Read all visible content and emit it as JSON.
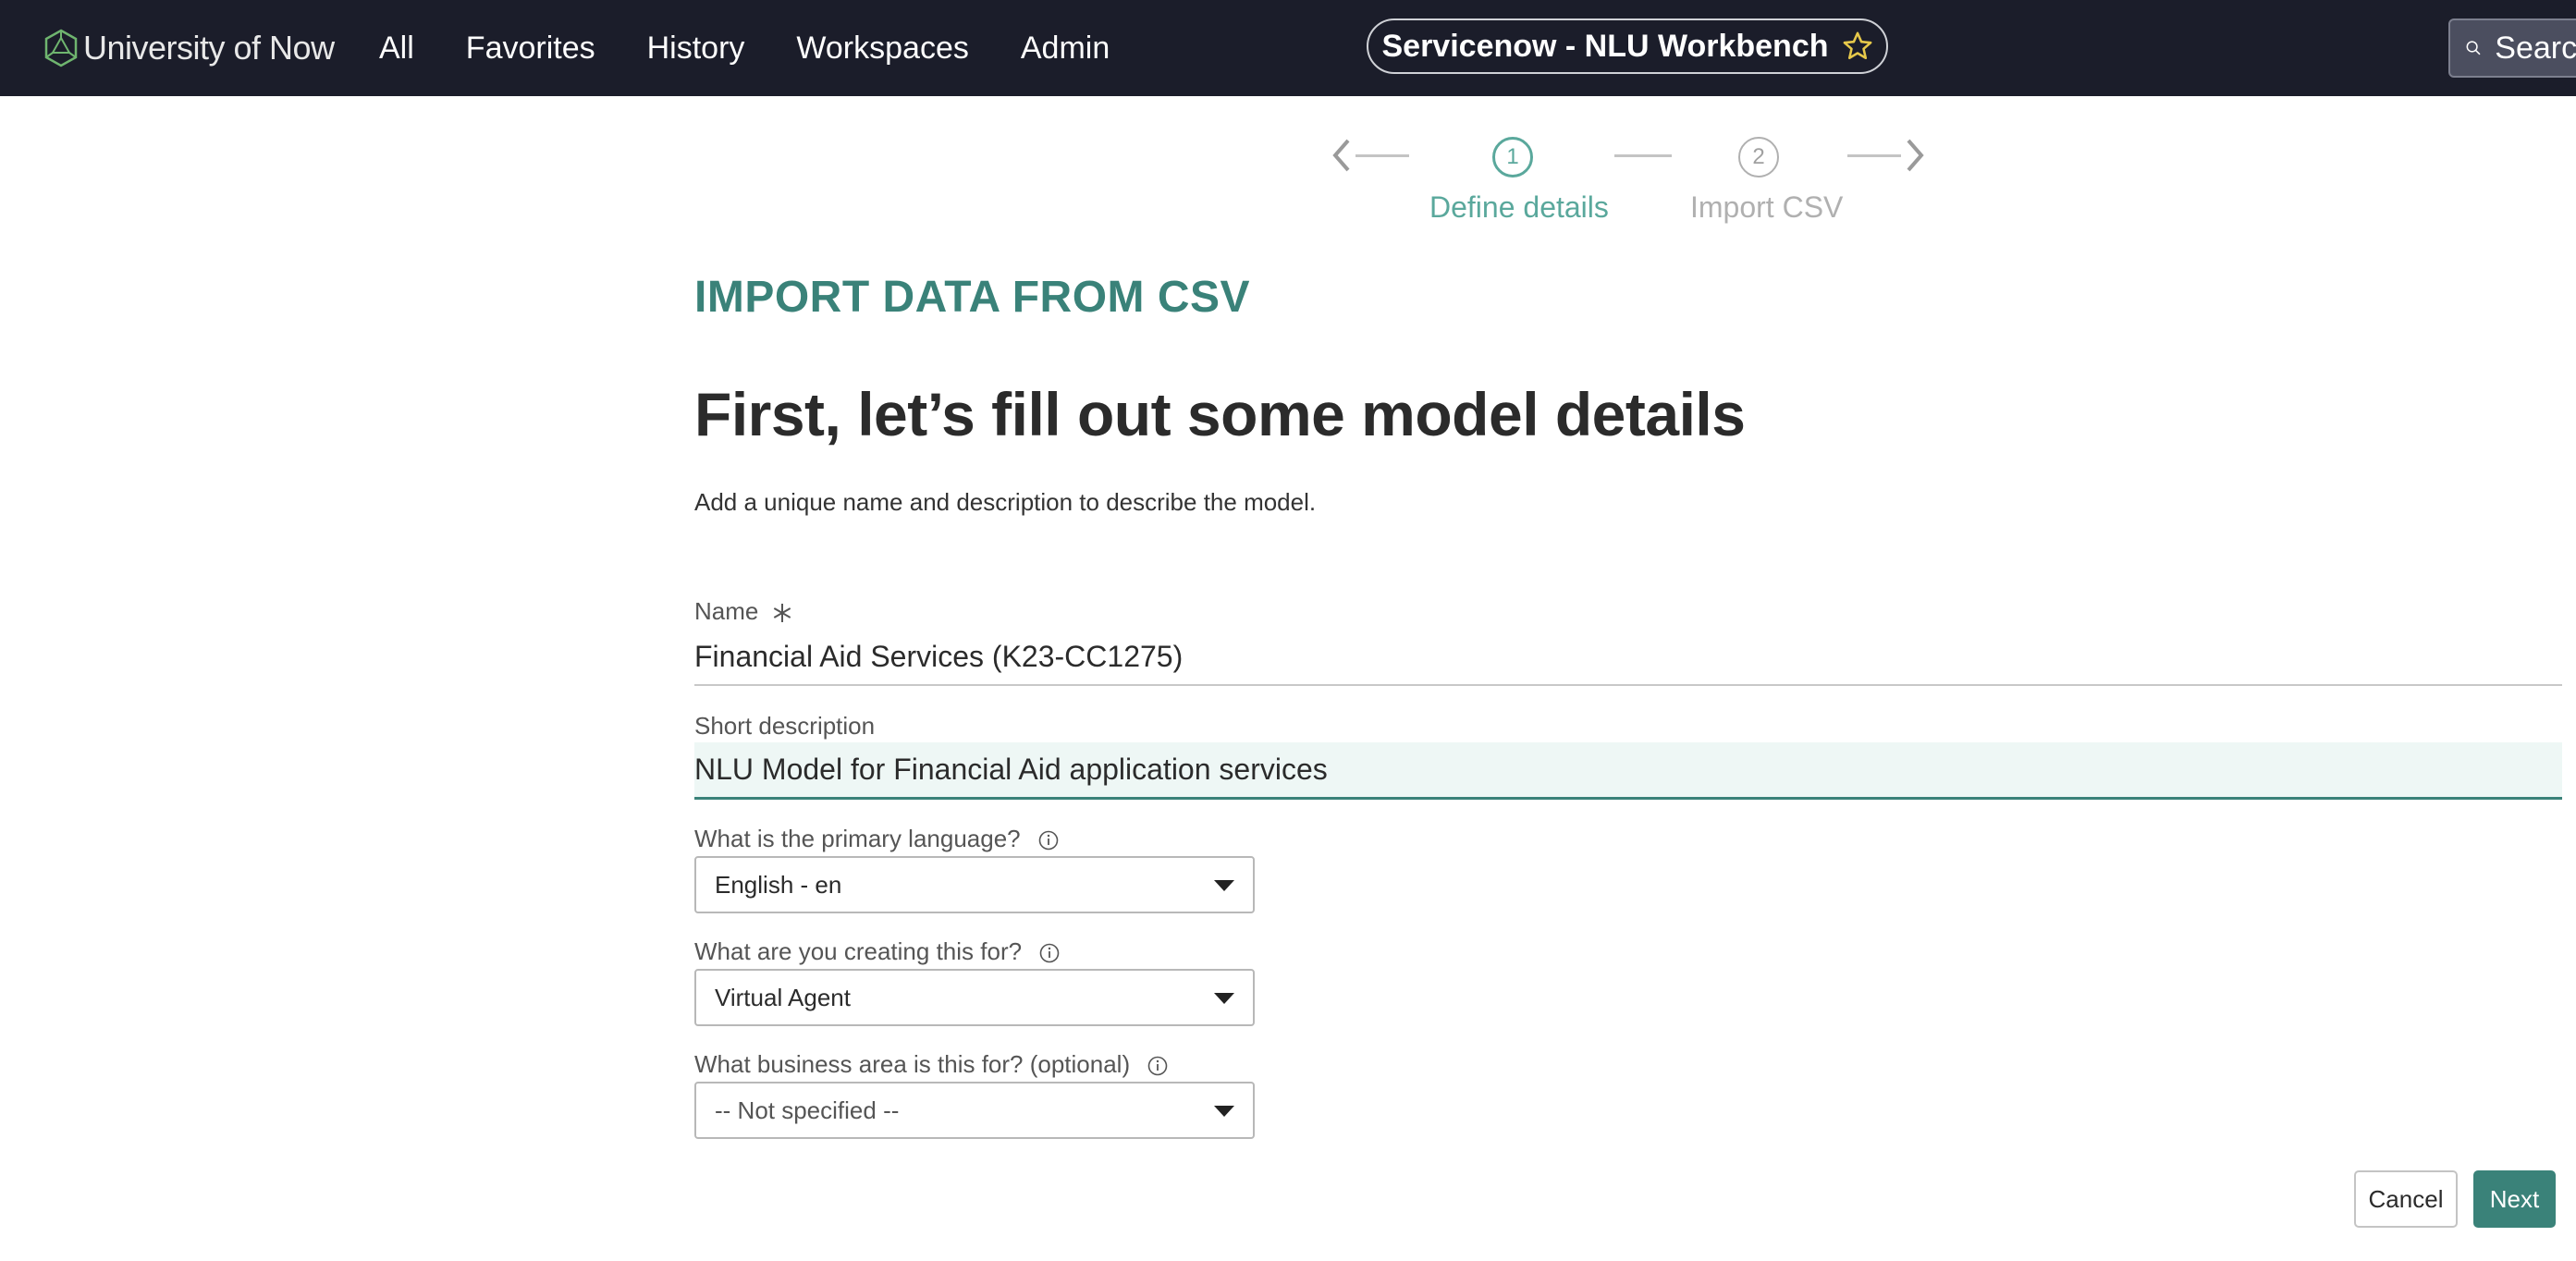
{
  "topbar": {
    "logo_text": "University of Now",
    "nav": [
      "All",
      "Favorites",
      "History",
      "Workspaces",
      "Admin"
    ],
    "app_title": "Servicenow - NLU Workbench",
    "search_placeholder": "Search"
  },
  "stepper": {
    "steps": [
      {
        "number": "1",
        "label": "Define details",
        "state": "active"
      },
      {
        "number": "2",
        "label": "Import CSV",
        "state": "inactive"
      }
    ]
  },
  "main": {
    "eyebrow": "IMPORT DATA FROM CSV",
    "headline": "First, let’s fill out some model details",
    "subtext": "Add a unique name and description to describe the model.",
    "name_label": "Name",
    "name_value": "Financial Aid Services (K23-CC1275)",
    "desc_label": "Short description",
    "desc_value": "NLU Model for Financial Aid application services",
    "language_label": "What is the primary language?",
    "language_value": "English - en",
    "purpose_label": "What are you creating this for?",
    "purpose_value": "Virtual Agent",
    "business_label": "What business area is this for? (optional)",
    "business_value": "-- Not specified --"
  },
  "actions": {
    "cancel": "Cancel",
    "next": "Next"
  },
  "colors": {
    "accent": "#3a8279",
    "topbar": "#1b1d2a",
    "step_active": "#5aa89c",
    "step_inactive": "#b0b0b0"
  },
  "icons": [
    "logo-icon",
    "star-icon",
    "search-icon",
    "chevron-left-icon",
    "chevron-right-icon",
    "required-asterisk-icon",
    "info-icon",
    "caret-down-icon"
  ]
}
